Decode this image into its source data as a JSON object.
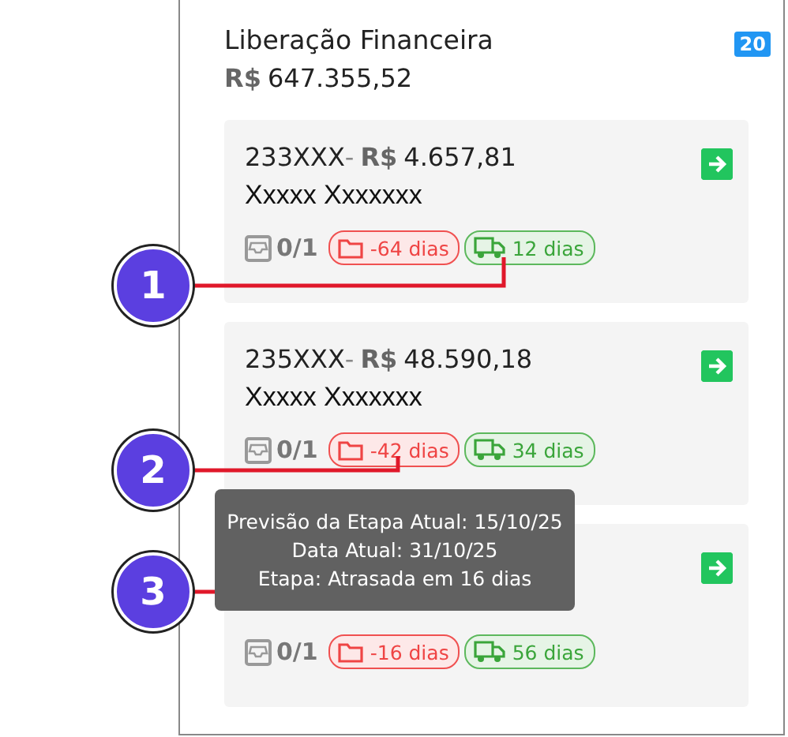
{
  "panel": {
    "title": "Liberação Financeira",
    "count": "20",
    "currency": "R$",
    "total": "647.355,52"
  },
  "cards": [
    {
      "code": "233XXX",
      "separator": "-",
      "currency": "R$",
      "amount": "4.657,81",
      "name": "Xxxxx Xxxxxxx",
      "docs": "0/1",
      "folder_days": "-64 dias",
      "truck_days": "12 dias"
    },
    {
      "code": "235XXX",
      "separator": "-",
      "currency": "R$",
      "amount": "48.590,18",
      "name": "Xxxxx Xxxxxxx",
      "docs": "0/1",
      "folder_days": "-42 dias",
      "truck_days": "34 dias"
    },
    {
      "docs": "0/1",
      "folder_days": "-16 dias",
      "truck_days": "56 dias"
    }
  ],
  "tooltip": {
    "lines": [
      "Previsão da Etapa Atual: 15/10/25",
      "Data Atual: 31/10/25",
      "Etapa: Atrasada em 16 dias"
    ]
  },
  "callouts": [
    {
      "number": "1"
    },
    {
      "number": "2"
    },
    {
      "number": "3"
    }
  ]
}
